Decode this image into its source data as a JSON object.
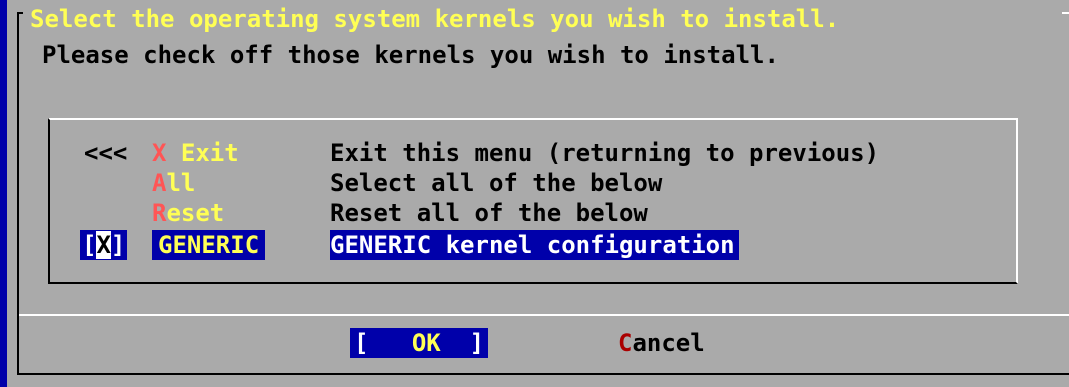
{
  "dialog": {
    "title": "Select the operating system kernels you wish to install.",
    "prompt": "Please check off those kernels you wish to install."
  },
  "menu": {
    "scroll_indicator": "<<<",
    "items": [
      {
        "hotkey": "X",
        "rest": " Exit",
        "description": "Exit this menu (returning to previous)"
      },
      {
        "hotkey": "A",
        "rest": "ll",
        "description": "Select all of the below"
      },
      {
        "hotkey": "R",
        "rest": "eset",
        "description": "Reset all of the below"
      },
      {
        "checkbox_open": "[",
        "checkbox_mark": "X",
        "checkbox_close": "]",
        "name": "GENERIC",
        "description": "GENERIC kernel configuration",
        "checked": true,
        "selected": true
      }
    ]
  },
  "buttons": {
    "ok_open": "[",
    "ok_label": "OK",
    "ok_close": "]",
    "cancel_hotkey": "C",
    "cancel_rest": "ancel"
  },
  "colors": {
    "background": "#aaaaaa",
    "title": "#ffff55",
    "hotkey": "#ff5555",
    "selection": "#0000aa"
  }
}
